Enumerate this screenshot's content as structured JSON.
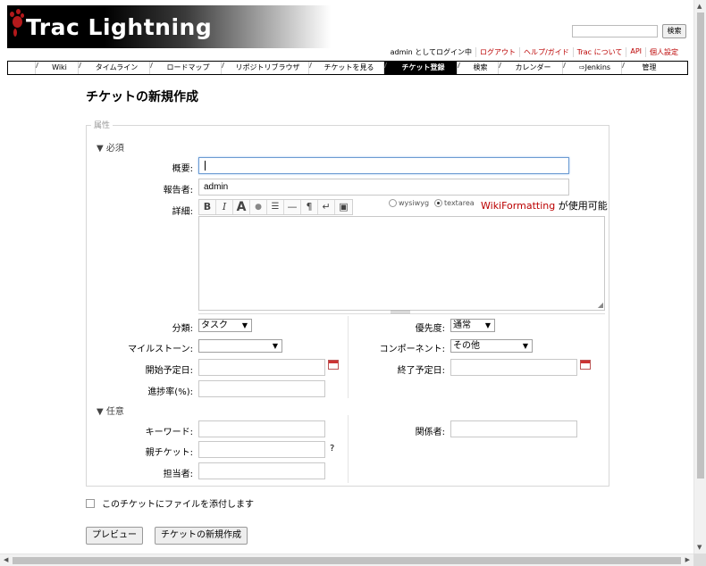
{
  "header": {
    "brand": "Trac Lightning",
    "search_button": "検索"
  },
  "metanav": [
    "admin としてログイン中",
    "ログアウト",
    "ヘルプ/ガイド",
    "Trac について",
    "API",
    "個人設定"
  ],
  "mainnav": {
    "items": [
      {
        "label": "Wiki",
        "w": 48
      },
      {
        "label": "タイムライン",
        "w": 80
      },
      {
        "label": "ロードマップ",
        "w": 80
      },
      {
        "label": "リポジトリブラウザ",
        "w": 98
      },
      {
        "label": "チケットを見る",
        "w": 84
      },
      {
        "label": "チケット登録",
        "w": 82,
        "active": true
      },
      {
        "label": "検索",
        "w": 46
      },
      {
        "label": "カレンダー",
        "w": 72
      },
      {
        "label": "⇨Jenkins",
        "w": 66
      },
      {
        "label": "管理",
        "w": 56
      }
    ]
  },
  "page": {
    "title": "チケットの新規作成",
    "legend": "属性",
    "required_section": "▼ 必須",
    "optional_section": "▼ 任意"
  },
  "fields": {
    "summary_label": "概要:",
    "reporter_label": "報告者:",
    "reporter_value": "admin",
    "description_label": "詳細:",
    "type_label": "分類:",
    "type_value": "タスク",
    "priority_label": "優先度:",
    "priority_value": "通常",
    "milestone_label": "マイルストーン:",
    "milestone_value": "",
    "component_label": "コンポーネント:",
    "component_value": "その他",
    "start_label": "開始予定日:",
    "end_label": "終了予定日:",
    "progress_label": "進捗率(%):",
    "keywords_label": "キーワード:",
    "cc_label": "関係者:",
    "parent_label": "親チケット:",
    "parent_help": "?",
    "owner_label": "担当者:"
  },
  "editor": {
    "mode_wysiwyg": "wysiwyg",
    "mode_textarea": "textarea",
    "selected_mode": "textarea",
    "wiki_link": "WikiFormatting",
    "wiki_suffix": " が使用可能",
    "toolbar": [
      "B",
      "I",
      "A",
      "●",
      "☰",
      "—",
      "¶",
      "↵",
      "▣"
    ]
  },
  "attach_label": "このチケットにファイルを添付します",
  "buttons": {
    "preview": "プレビュー",
    "create": "チケットの新規作成"
  }
}
